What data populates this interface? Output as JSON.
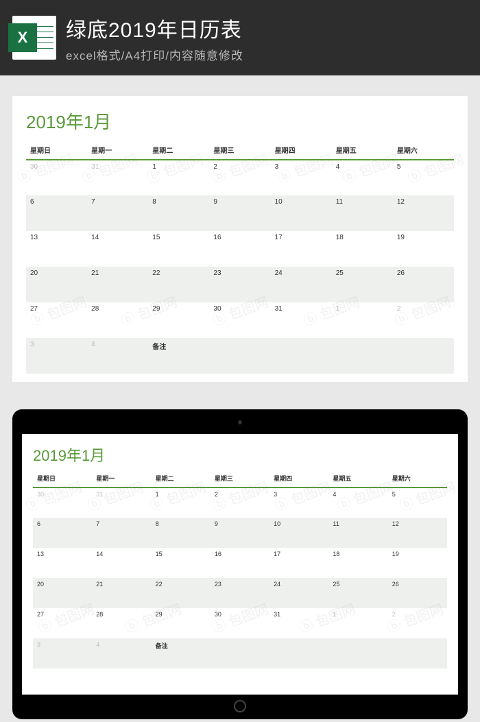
{
  "header": {
    "excel_letter": "X",
    "title": "绿底2019年日历表",
    "subtitle": "excel格式/A4打印/内容随意修改"
  },
  "watermark_text": "包图网",
  "calendar": {
    "title": "2019年1月",
    "note_label": "备注",
    "weekdays": [
      "星期日",
      "星期一",
      "星期二",
      "星期三",
      "星期四",
      "星期五",
      "星期六"
    ],
    "rows": [
      {
        "alt": false,
        "cells": [
          {
            "v": "30",
            "muted": true
          },
          {
            "v": "31",
            "muted": true
          },
          {
            "v": "1"
          },
          {
            "v": "2"
          },
          {
            "v": "3"
          },
          {
            "v": "4"
          },
          {
            "v": "5"
          }
        ]
      },
      {
        "alt": true,
        "cells": [
          {
            "v": "6"
          },
          {
            "v": "7"
          },
          {
            "v": "8"
          },
          {
            "v": "9"
          },
          {
            "v": "10"
          },
          {
            "v": "11"
          },
          {
            "v": "12"
          }
        ]
      },
      {
        "alt": false,
        "cells": [
          {
            "v": "13"
          },
          {
            "v": "14"
          },
          {
            "v": "15"
          },
          {
            "v": "16"
          },
          {
            "v": "17"
          },
          {
            "v": "18"
          },
          {
            "v": "19"
          }
        ]
      },
      {
        "alt": true,
        "cells": [
          {
            "v": "20"
          },
          {
            "v": "21"
          },
          {
            "v": "22"
          },
          {
            "v": "23"
          },
          {
            "v": "24"
          },
          {
            "v": "25"
          },
          {
            "v": "26"
          }
        ]
      },
      {
        "alt": false,
        "cells": [
          {
            "v": "27"
          },
          {
            "v": "28"
          },
          {
            "v": "29"
          },
          {
            "v": "30"
          },
          {
            "v": "31"
          },
          {
            "v": "1",
            "muted": true
          },
          {
            "v": "2",
            "muted": true
          }
        ]
      },
      {
        "alt": true,
        "cells": [
          {
            "v": "3",
            "muted": true
          },
          {
            "v": "4",
            "muted": true
          },
          {
            "v": "备注",
            "note": true
          },
          {
            "v": ""
          },
          {
            "v": ""
          },
          {
            "v": ""
          },
          {
            "v": ""
          }
        ]
      }
    ]
  }
}
